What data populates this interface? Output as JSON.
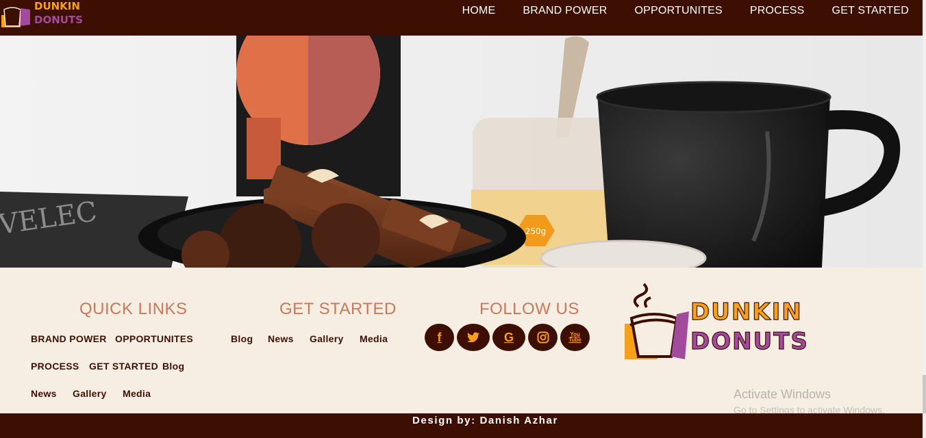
{
  "brand": {
    "word1": "DUNKIN",
    "word2": "DONUTS"
  },
  "nav": {
    "items": [
      "HOME",
      "BRAND POWER",
      "OPPORTUNITES",
      "PROCESS",
      "GET STARTED"
    ]
  },
  "hero": {
    "jar_label": "250g"
  },
  "footer": {
    "quick_links": {
      "title": "QUICK LINKS",
      "items": [
        "BRAND POWER",
        "OPPORTUNITES",
        "PROCESS",
        "GET STARTED",
        "Blog",
        "News",
        "Gallery",
        "Media"
      ]
    },
    "get_started": {
      "title": "GET STARTED",
      "items": [
        "Blog",
        "News",
        "Gallery",
        "Media"
      ]
    },
    "follow_us": {
      "title": "FOLLOW US",
      "icons": [
        "facebook-icon",
        "twitter-icon",
        "google-icon",
        "instagram-icon",
        "youtube-icon"
      ],
      "glyphs": [
        "f",
        "t",
        "G",
        "◎",
        "You Tube"
      ]
    }
  },
  "watermark": {
    "line1": "Activate Windows",
    "line2": "Go to Settings to activate Windows."
  },
  "credit": "Design by: Danish Azhar",
  "colors": {
    "dark_brown": "#3d0f03",
    "cream": "#f6eee2",
    "orange": "#f7a11a",
    "purple": "#a24b9d",
    "title_terracotta": "#c8785a"
  }
}
